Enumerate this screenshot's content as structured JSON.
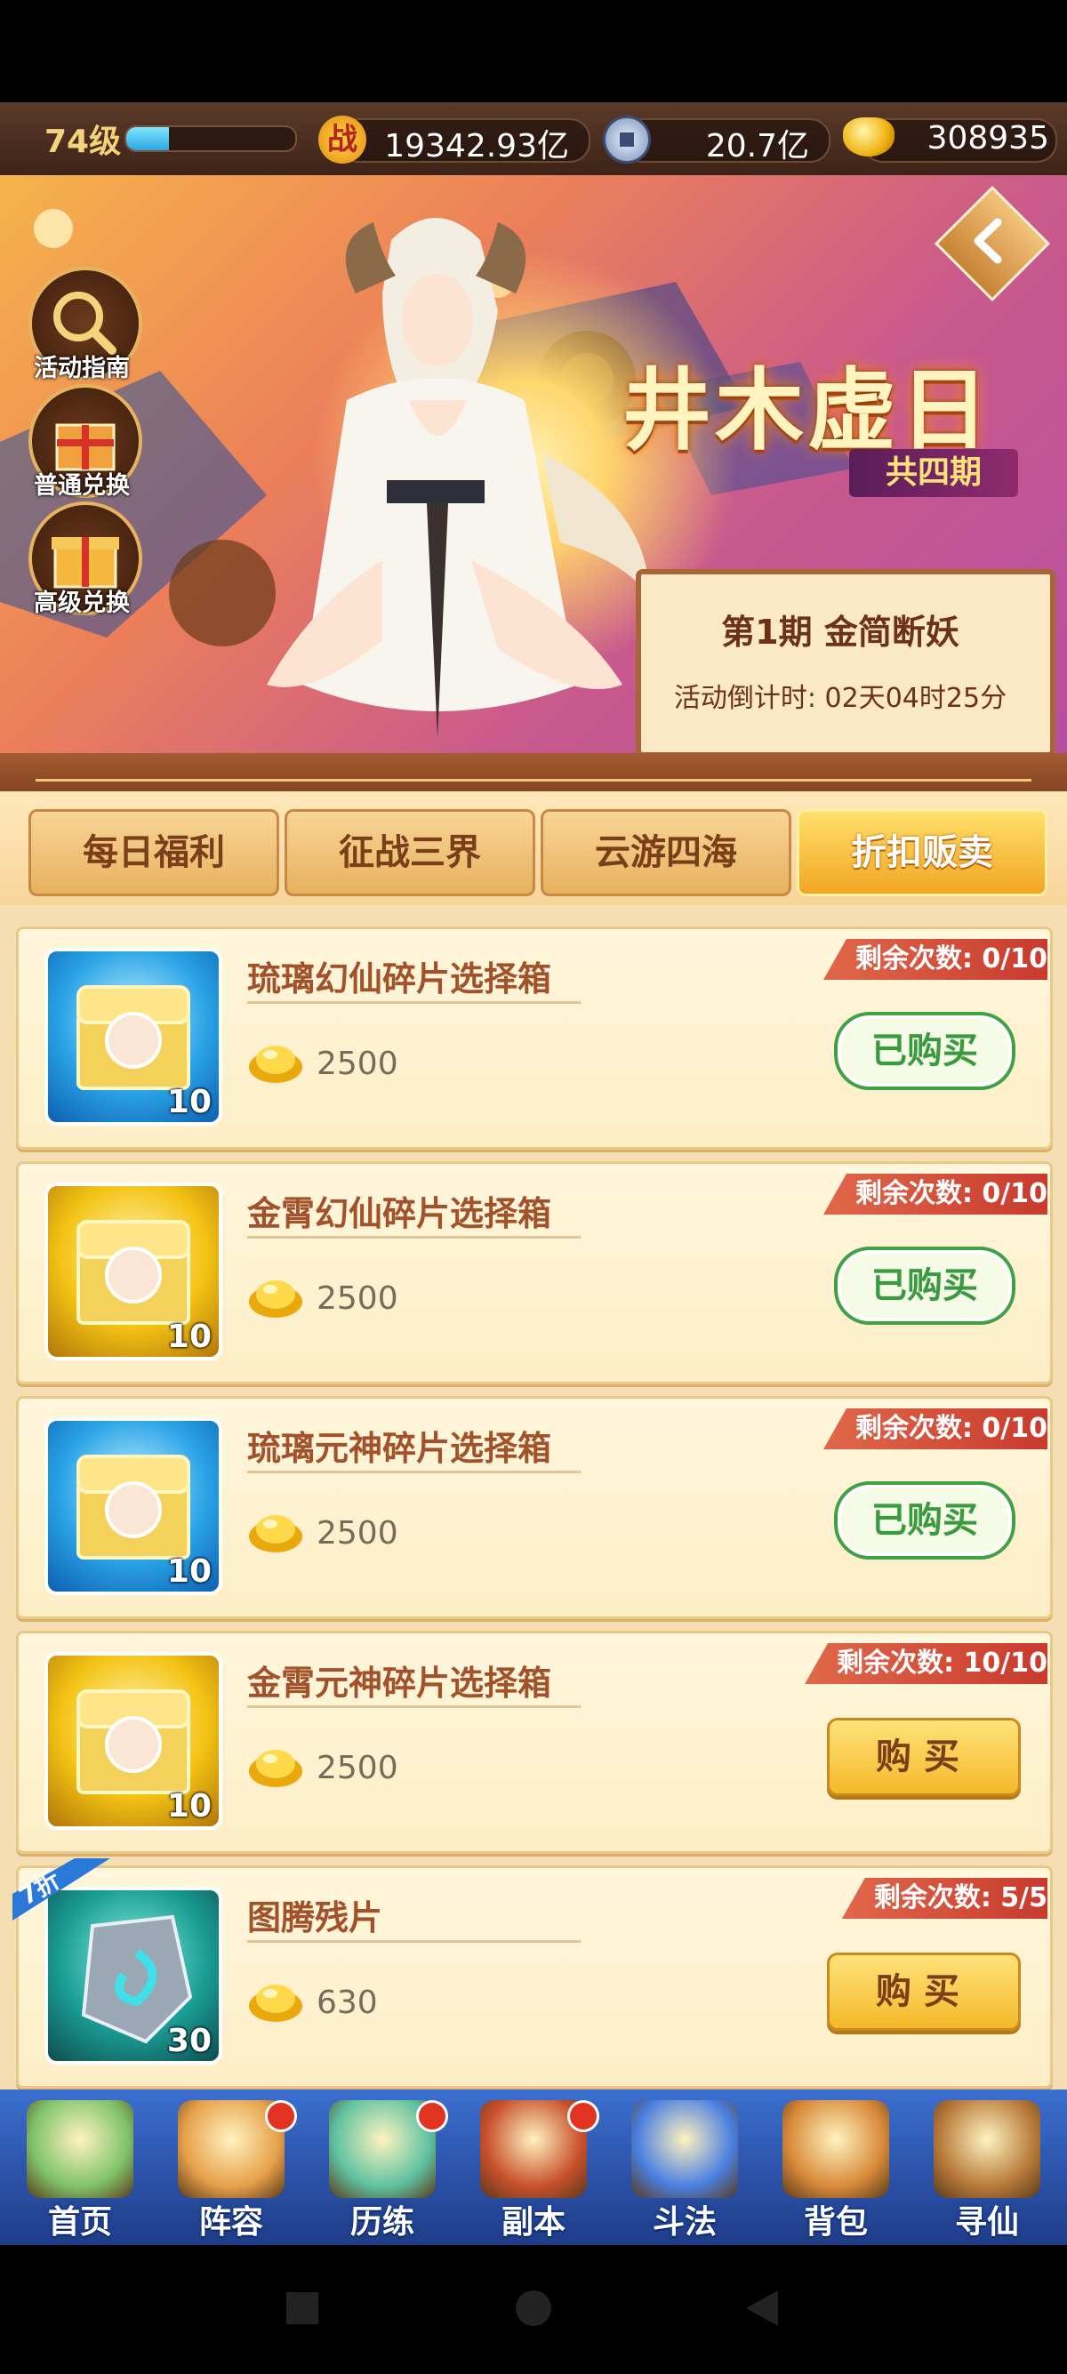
{
  "player": {
    "level": "74级",
    "exp_fraction": 0.25,
    "power_icon": "战",
    "power": "19342.93亿",
    "silver": "20.7亿",
    "gold": "308935"
  },
  "banner": {
    "title": "井木虚日",
    "subtitle": "共四期",
    "period_title": "第1期  金简断妖",
    "countdown": "活动倒计时: 02天04时25分",
    "side_buttons": [
      {
        "label": "活动指南",
        "icon": "magnifier-icon"
      },
      {
        "label": "普通兑换",
        "icon": "gift-box-icon"
      },
      {
        "label": "高级兑换",
        "icon": "gift-box-icon"
      }
    ]
  },
  "tabs": [
    {
      "label": "每日福利",
      "active": false
    },
    {
      "label": "征战三界",
      "active": false
    },
    {
      "label": "云游四海",
      "active": false
    },
    {
      "label": "折扣贩卖",
      "active": true
    }
  ],
  "items": [
    {
      "name": "琉璃幻仙碎片选择箱",
      "qty": "10",
      "price": "2500",
      "remain": "剩余次数: 0/10",
      "action": "已购买",
      "bought": true,
      "style": "blue"
    },
    {
      "name": "金霄幻仙碎片选择箱",
      "qty": "10",
      "price": "2500",
      "remain": "剩余次数: 0/10",
      "action": "已购买",
      "bought": true,
      "style": "gold"
    },
    {
      "name": "琉璃元神碎片选择箱",
      "qty": "10",
      "price": "2500",
      "remain": "剩余次数: 0/10",
      "action": "已购买",
      "bought": true,
      "style": "blue"
    },
    {
      "name": "金霄元神碎片选择箱",
      "qty": "10",
      "price": "2500",
      "remain": "剩余次数: 10/10",
      "action": "购买",
      "bought": false,
      "style": "gold"
    },
    {
      "name": "图腾残片",
      "qty": "30",
      "price": "630",
      "remain": "剩余次数: 5/5",
      "action": "购买",
      "bought": false,
      "style": "teal",
      "discount": "7折"
    }
  ],
  "nav": [
    {
      "label": "首页",
      "dot": false
    },
    {
      "label": "阵容",
      "dot": true
    },
    {
      "label": "历练",
      "dot": true
    },
    {
      "label": "副本",
      "dot": true
    },
    {
      "label": "斗法",
      "dot": false
    },
    {
      "label": "背包",
      "dot": false
    },
    {
      "label": "寻仙",
      "dot": false
    }
  ],
  "colors": {
    "accent_gold": "#f3b929",
    "bought_green": "#3a9a40",
    "remain_red": "#c83a2e",
    "item_name": "#a2522b"
  }
}
